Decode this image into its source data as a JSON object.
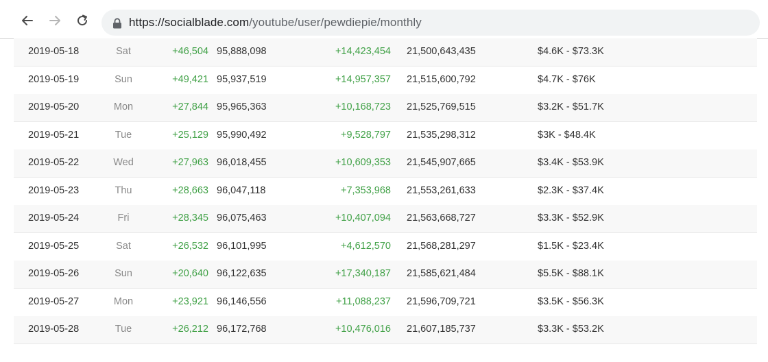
{
  "browser": {
    "url_host": "https://socialblade.com",
    "url_path": "/youtube/user/pewdiepie/monthly"
  },
  "rows": [
    {
      "date": "2019-05-18",
      "day": "Sat",
      "subs_gain": "+46,504",
      "subs": "95,888,098",
      "views_gain": "+14,423,454",
      "views": "21,500,643,435",
      "earnings": "$4.6K  -  $73.3K"
    },
    {
      "date": "2019-05-19",
      "day": "Sun",
      "subs_gain": "+49,421",
      "subs": "95,937,519",
      "views_gain": "+14,957,357",
      "views": "21,515,600,792",
      "earnings": "$4.7K  -  $76K"
    },
    {
      "date": "2019-05-20",
      "day": "Mon",
      "subs_gain": "+27,844",
      "subs": "95,965,363",
      "views_gain": "+10,168,723",
      "views": "21,525,769,515",
      "earnings": "$3.2K  -  $51.7K"
    },
    {
      "date": "2019-05-21",
      "day": "Tue",
      "subs_gain": "+25,129",
      "subs": "95,990,492",
      "views_gain": "+9,528,797",
      "views": "21,535,298,312",
      "earnings": "$3K  -  $48.4K"
    },
    {
      "date": "2019-05-22",
      "day": "Wed",
      "subs_gain": "+27,963",
      "subs": "96,018,455",
      "views_gain": "+10,609,353",
      "views": "21,545,907,665",
      "earnings": "$3.4K  -  $53.9K"
    },
    {
      "date": "2019-05-23",
      "day": "Thu",
      "subs_gain": "+28,663",
      "subs": "96,047,118",
      "views_gain": "+7,353,968",
      "views": "21,553,261,633",
      "earnings": "$2.3K  -  $37.4K"
    },
    {
      "date": "2019-05-24",
      "day": "Fri",
      "subs_gain": "+28,345",
      "subs": "96,075,463",
      "views_gain": "+10,407,094",
      "views": "21,563,668,727",
      "earnings": "$3.3K  -  $52.9K"
    },
    {
      "date": "2019-05-25",
      "day": "Sat",
      "subs_gain": "+26,532",
      "subs": "96,101,995",
      "views_gain": "+4,612,570",
      "views": "21,568,281,297",
      "earnings": "$1.5K  -  $23.4K"
    },
    {
      "date": "2019-05-26",
      "day": "Sun",
      "subs_gain": "+20,640",
      "subs": "96,122,635",
      "views_gain": "+17,340,187",
      "views": "21,585,621,484",
      "earnings": "$5.5K  -  $88.1K"
    },
    {
      "date": "2019-05-27",
      "day": "Mon",
      "subs_gain": "+23,921",
      "subs": "96,146,556",
      "views_gain": "+11,088,237",
      "views": "21,596,709,721",
      "earnings": "$3.5K  -  $56.3K"
    },
    {
      "date": "2019-05-28",
      "day": "Tue",
      "subs_gain": "+26,212",
      "subs": "96,172,768",
      "views_gain": "+10,476,016",
      "views": "21,607,185,737",
      "earnings": "$3.3K  -  $53.2K"
    }
  ]
}
